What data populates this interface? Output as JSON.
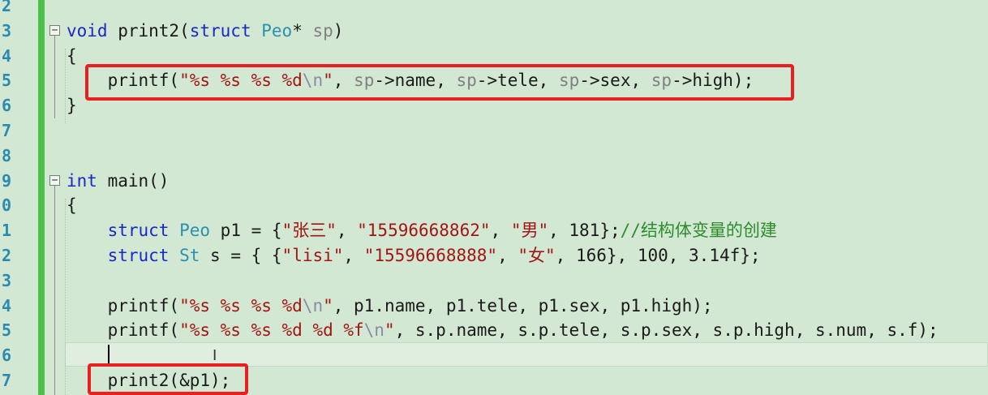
{
  "editor": {
    "line_numbers": [
      "2",
      "3",
      "4",
      "5",
      "6",
      "7",
      "8",
      "9",
      "0",
      "1",
      "2",
      "3",
      "4",
      "5",
      "6",
      "7"
    ],
    "lines": [
      {
        "segments": []
      },
      {
        "segments": [
          {
            "t": "void",
            "c": "kw"
          },
          {
            "t": " print2(",
            "c": "nm"
          },
          {
            "t": "struct",
            "c": "kw"
          },
          {
            "t": " ",
            "c": "nm"
          },
          {
            "t": "Peo",
            "c": "ty"
          },
          {
            "t": "* ",
            "c": "nm"
          },
          {
            "t": "sp",
            "c": "pa"
          },
          {
            "t": ")",
            "c": "nm"
          }
        ]
      },
      {
        "segments": [
          {
            "t": "{",
            "c": "nm"
          }
        ]
      },
      {
        "segments": [
          {
            "t": "    printf(",
            "c": "nm"
          },
          {
            "t": "\"%s %s %s %d",
            "c": "st"
          },
          {
            "t": "\\n",
            "c": "es"
          },
          {
            "t": "\"",
            "c": "st"
          },
          {
            "t": ", ",
            "c": "nm"
          },
          {
            "t": "sp",
            "c": "pa"
          },
          {
            "t": "->name, ",
            "c": "nm"
          },
          {
            "t": "sp",
            "c": "pa"
          },
          {
            "t": "->tele, ",
            "c": "nm"
          },
          {
            "t": "sp",
            "c": "pa"
          },
          {
            "t": "->sex, ",
            "c": "nm"
          },
          {
            "t": "sp",
            "c": "pa"
          },
          {
            "t": "->high);",
            "c": "nm"
          }
        ]
      },
      {
        "segments": [
          {
            "t": "}",
            "c": "nm"
          }
        ]
      },
      {
        "segments": []
      },
      {
        "segments": []
      },
      {
        "segments": [
          {
            "t": "int",
            "c": "kw"
          },
          {
            "t": " main()",
            "c": "nm"
          }
        ]
      },
      {
        "segments": [
          {
            "t": "{",
            "c": "nm"
          }
        ]
      },
      {
        "segments": [
          {
            "t": "    ",
            "c": "nm"
          },
          {
            "t": "struct",
            "c": "kw"
          },
          {
            "t": " ",
            "c": "nm"
          },
          {
            "t": "Peo",
            "c": "ty"
          },
          {
            "t": " p1 = {",
            "c": "nm"
          },
          {
            "t": "\"张三\"",
            "c": "st"
          },
          {
            "t": ", ",
            "c": "nm"
          },
          {
            "t": "\"15596668862\"",
            "c": "st"
          },
          {
            "t": ", ",
            "c": "nm"
          },
          {
            "t": "\"男\"",
            "c": "st"
          },
          {
            "t": ", 181};",
            "c": "nm"
          },
          {
            "t": "//结构体变量的创建",
            "c": "cm"
          }
        ]
      },
      {
        "segments": [
          {
            "t": "    ",
            "c": "nm"
          },
          {
            "t": "struct",
            "c": "kw"
          },
          {
            "t": " ",
            "c": "nm"
          },
          {
            "t": "St",
            "c": "ty"
          },
          {
            "t": " s = { {",
            "c": "nm"
          },
          {
            "t": "\"lisi\"",
            "c": "st"
          },
          {
            "t": ", ",
            "c": "nm"
          },
          {
            "t": "\"15596668888\"",
            "c": "st"
          },
          {
            "t": ", ",
            "c": "nm"
          },
          {
            "t": "\"女\"",
            "c": "st"
          },
          {
            "t": ", 166}, 100, 3.14f};",
            "c": "nm"
          }
        ]
      },
      {
        "segments": []
      },
      {
        "segments": [
          {
            "t": "    printf(",
            "c": "nm"
          },
          {
            "t": "\"%s %s %s %d",
            "c": "st"
          },
          {
            "t": "\\n",
            "c": "es"
          },
          {
            "t": "\"",
            "c": "st"
          },
          {
            "t": ", p1.name, p1.tele, p1.sex, p1.high);",
            "c": "nm"
          }
        ]
      },
      {
        "segments": [
          {
            "t": "    printf(",
            "c": "nm"
          },
          {
            "t": "\"%s %s %s %d %d %f",
            "c": "st"
          },
          {
            "t": "\\n",
            "c": "es"
          },
          {
            "t": "\"",
            "c": "st"
          },
          {
            "t": ", s.p.name, s.p.tele, s.p.sex, s.p.high, s.num, s.f);",
            "c": "nm"
          }
        ]
      },
      {
        "segments": []
      },
      {
        "segments": [
          {
            "t": "    print2(&p1);",
            "c": "nm"
          }
        ]
      }
    ]
  },
  "colors": {
    "background": "#d2e8d2",
    "keyword": "#1a28c8",
    "type": "#2b91af",
    "string": "#a31515",
    "comment": "#2e8b2e",
    "highlight_box": "#e82020",
    "change_bar": "#4cc24c"
  },
  "icons": [
    "collapse-icon",
    "text-cursor-icon"
  ]
}
